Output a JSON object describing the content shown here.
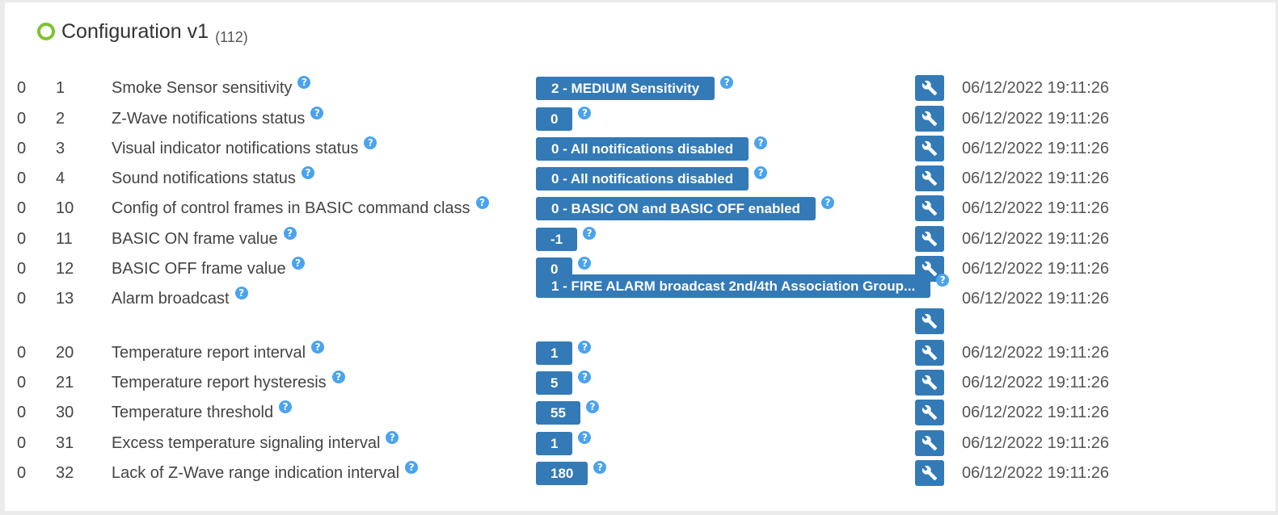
{
  "header": {
    "title": "Configuration v1",
    "count": "(112)"
  },
  "icons": {
    "status": "circle-status-icon",
    "help": "question-icon",
    "edit": "wrench-icon"
  },
  "colors": {
    "accent": "#337ab7",
    "status_ok": "#7cc233",
    "help": "#4aa3ee"
  },
  "help_glyph": "?",
  "rows": [
    {
      "instance": "0",
      "index": "1",
      "name": "Smoke Sensor sensitivity",
      "value": "2 - MEDIUM Sensitivity",
      "date": "06/12/2022 19:11:26"
    },
    {
      "instance": "0",
      "index": "2",
      "name": "Z-Wave notifications status",
      "value": "0",
      "date": "06/12/2022 19:11:26"
    },
    {
      "instance": "0",
      "index": "3",
      "name": "Visual indicator notifications status",
      "value": "0 - All notifications disabled",
      "date": "06/12/2022 19:11:26"
    },
    {
      "instance": "0",
      "index": "4",
      "name": "Sound notifications status",
      "value": "0 - All notifications disabled",
      "date": "06/12/2022 19:11:26"
    },
    {
      "instance": "0",
      "index": "10",
      "name": "Config of control frames in BASIC command class",
      "value": "0 - BASIC ON and BASIC OFF enabled",
      "date": "06/12/2022 19:11:26"
    },
    {
      "instance": "0",
      "index": "11",
      "name": "BASIC ON frame value",
      "value": "-1",
      "date": "06/12/2022 19:11:26"
    },
    {
      "instance": "0",
      "index": "12",
      "name": "BASIC OFF frame value",
      "value": "0",
      "date": "06/12/2022 19:11:26"
    },
    {
      "instance": "0",
      "index": "13",
      "name": "Alarm broadcast",
      "value": "1 - FIRE ALARM broadcast 2nd/4th Association Group...",
      "date": "06/12/2022 19:11:26"
    },
    {
      "instance": "0",
      "index": "20",
      "name": "Temperature report interval",
      "value": "1",
      "date": "06/12/2022 19:11:26"
    },
    {
      "instance": "0",
      "index": "21",
      "name": "Temperature report hysteresis",
      "value": "5",
      "date": "06/12/2022 19:11:26"
    },
    {
      "instance": "0",
      "index": "30",
      "name": "Temperature threshold",
      "value": "55",
      "date": "06/12/2022 19:11:26"
    },
    {
      "instance": "0",
      "index": "31",
      "name": "Excess temperature signaling interval",
      "value": "1",
      "date": "06/12/2022 19:11:26"
    },
    {
      "instance": "0",
      "index": "32",
      "name": "Lack of Z-Wave range indication interval",
      "value": "180",
      "date": "06/12/2022 19:11:26"
    }
  ]
}
